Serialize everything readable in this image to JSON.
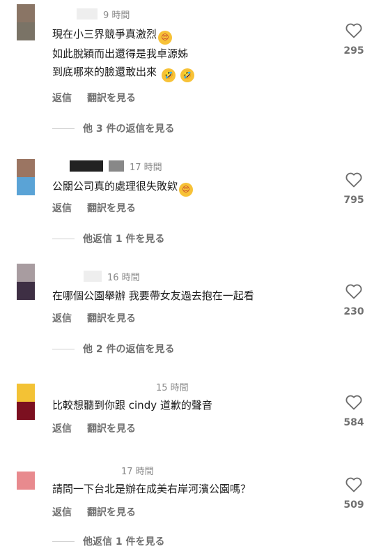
{
  "comments": [
    {
      "avatar_colors": [
        "#8a7565",
        "#7a7366"
      ],
      "time": "9 時間",
      "lines": [
        "現在小三界競爭真激烈",
        "如此脫穎而出還得是我卓源姊",
        "到底哪來的臉還敢出來"
      ],
      "emojis": [
        "😍",
        "🤣",
        "🤣"
      ],
      "reply_label": "返信",
      "translate_label": "翻訳を見る",
      "more_replies": "他 3 件の返信を見る",
      "likes": "295"
    },
    {
      "avatar_colors": [
        "#9b7562",
        "#5aa3d6"
      ],
      "time": "17 時間",
      "lines": [
        "公關公司真的處理很失敗欸"
      ],
      "emojis": [
        "😍"
      ],
      "reply_label": "返信",
      "translate_label": "翻訳を見る",
      "more_replies": "他返信 1 件を見る",
      "likes": "795"
    },
    {
      "avatar_colors": [
        "#a89ca0",
        "#3e2f44"
      ],
      "time": "16 時間",
      "lines": [
        "在哪個公園舉辦 我要帶女友過去抱在一起看"
      ],
      "emojis": [],
      "reply_label": "返信",
      "translate_label": "翻訳を見る",
      "more_replies": "他 2 件の返信を見る",
      "likes": "230"
    },
    {
      "avatar_colors": [
        "#f3c235",
        "#7c1020"
      ],
      "time": "15 時間",
      "lines": [
        "比較想聽到你跟 cindy 道歉的聲音"
      ],
      "emojis": [],
      "reply_label": "返信",
      "translate_label": "翻訳を見る",
      "more_replies": "",
      "likes": "584"
    },
    {
      "avatar_colors": [
        "#e88a8e",
        "#ffffff"
      ],
      "time": "17 時間",
      "lines": [
        "請問一下台北是辦在成美右岸河濱公園嗎？"
      ],
      "emojis": [],
      "reply_label": "返信",
      "translate_label": "翻訳を見る",
      "more_replies": "他返信 1 件を見る",
      "likes": "509"
    }
  ]
}
